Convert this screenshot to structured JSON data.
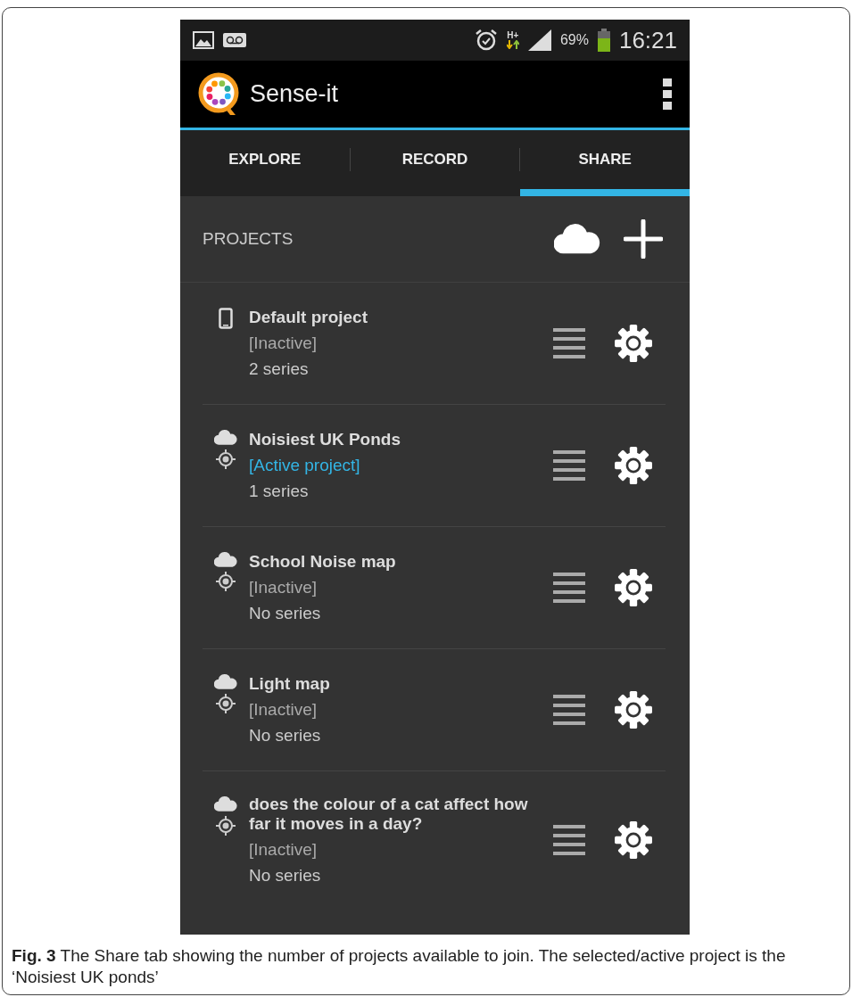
{
  "status_bar": {
    "network": "H+",
    "battery": "69%",
    "time": "16:21"
  },
  "app_bar": {
    "title": "Sense-it"
  },
  "tabs": [
    {
      "label": "EXPLORE",
      "selected": false
    },
    {
      "label": "RECORD",
      "selected": false
    },
    {
      "label": "SHARE",
      "selected": true
    }
  ],
  "projects_header": {
    "label": "PROJECTS"
  },
  "projects": [
    {
      "kind": "device",
      "name": "Default project",
      "status": "[Inactive]",
      "active": false,
      "series": "2 series"
    },
    {
      "kind": "cloud",
      "name": "Noisiest UK Ponds",
      "status": "[Active project]",
      "active": true,
      "series": "1 series"
    },
    {
      "kind": "cloud",
      "name": "School Noise map",
      "status": "[Inactive]",
      "active": false,
      "series": "No series"
    },
    {
      "kind": "cloud",
      "name": "Light map",
      "status": "[Inactive]",
      "active": false,
      "series": "No series"
    },
    {
      "kind": "cloud",
      "name": "does the colour of a cat affect how far it moves in a day?",
      "status": "[Inactive]",
      "active": false,
      "series": "No series"
    }
  ],
  "caption": "**Fig. 3** The Share tab showing the number of projects available to join. The selected/active project is the ‘Noisiest UK ponds’"
}
